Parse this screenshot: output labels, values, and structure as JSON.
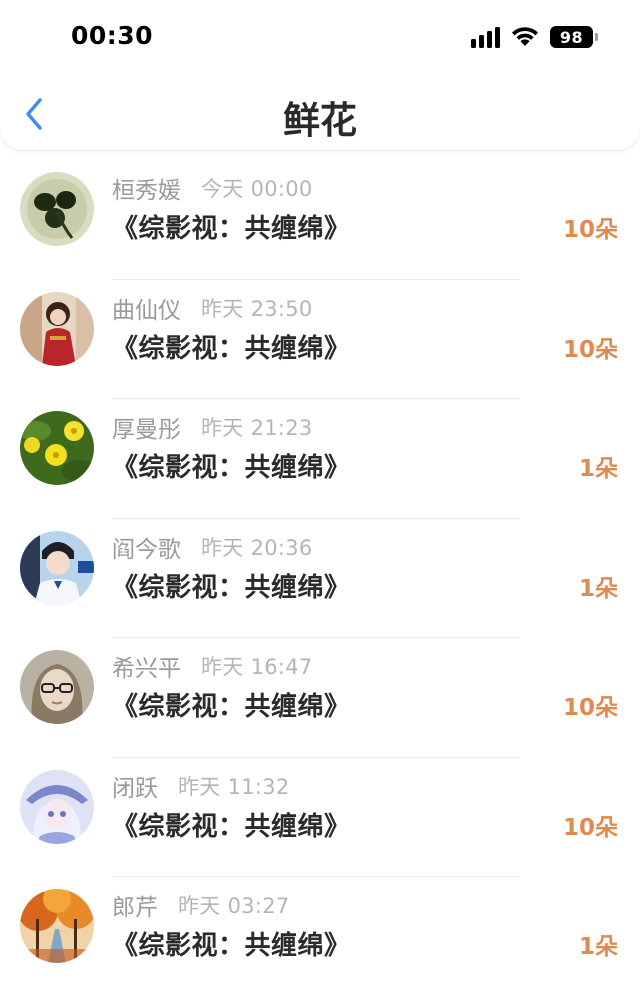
{
  "status_bar": {
    "time": "00:30",
    "battery": "98"
  },
  "nav": {
    "title": "鲜花"
  },
  "items": [
    {
      "name": "桓秀媛",
      "time": "今天 00:00",
      "book": "《综影视：共缠绵》",
      "count": "10朵",
      "avatar": "clover-avatar"
    },
    {
      "name": "曲仙仪",
      "time": "昨天 23:50",
      "book": "《综影视：共缠绵》",
      "count": "10朵",
      "avatar": "girl-red-dress-avatar"
    },
    {
      "name": "厚曼彤",
      "time": "昨天 21:23",
      "book": "《综影视：共缠绵》",
      "count": "1朵",
      "avatar": "yellow-flowers-avatar"
    },
    {
      "name": "阎今歌",
      "time": "昨天 20:36",
      "book": "《综影视：共缠绵》",
      "count": "1朵",
      "avatar": "boy-uniform-avatar"
    },
    {
      "name": "希兴平",
      "time": "昨天 16:47",
      "book": "《综影视：共缠绵》",
      "count": "10朵",
      "avatar": "doll-glasses-avatar"
    },
    {
      "name": "闭跃",
      "time": "昨天 11:32",
      "book": "《综影视：共缠绵》",
      "count": "10朵",
      "avatar": "anime-girl-avatar"
    },
    {
      "name": "郎芹",
      "time": "昨天 03:27",
      "book": "《综影视：共缠绵》",
      "count": "1朵",
      "avatar": "autumn-trees-avatar"
    }
  ],
  "colors": {
    "count": "#e08a50",
    "back_icon": "#3b8ef0",
    "name": "#9a9a9a",
    "time": "#b5b5b5"
  }
}
